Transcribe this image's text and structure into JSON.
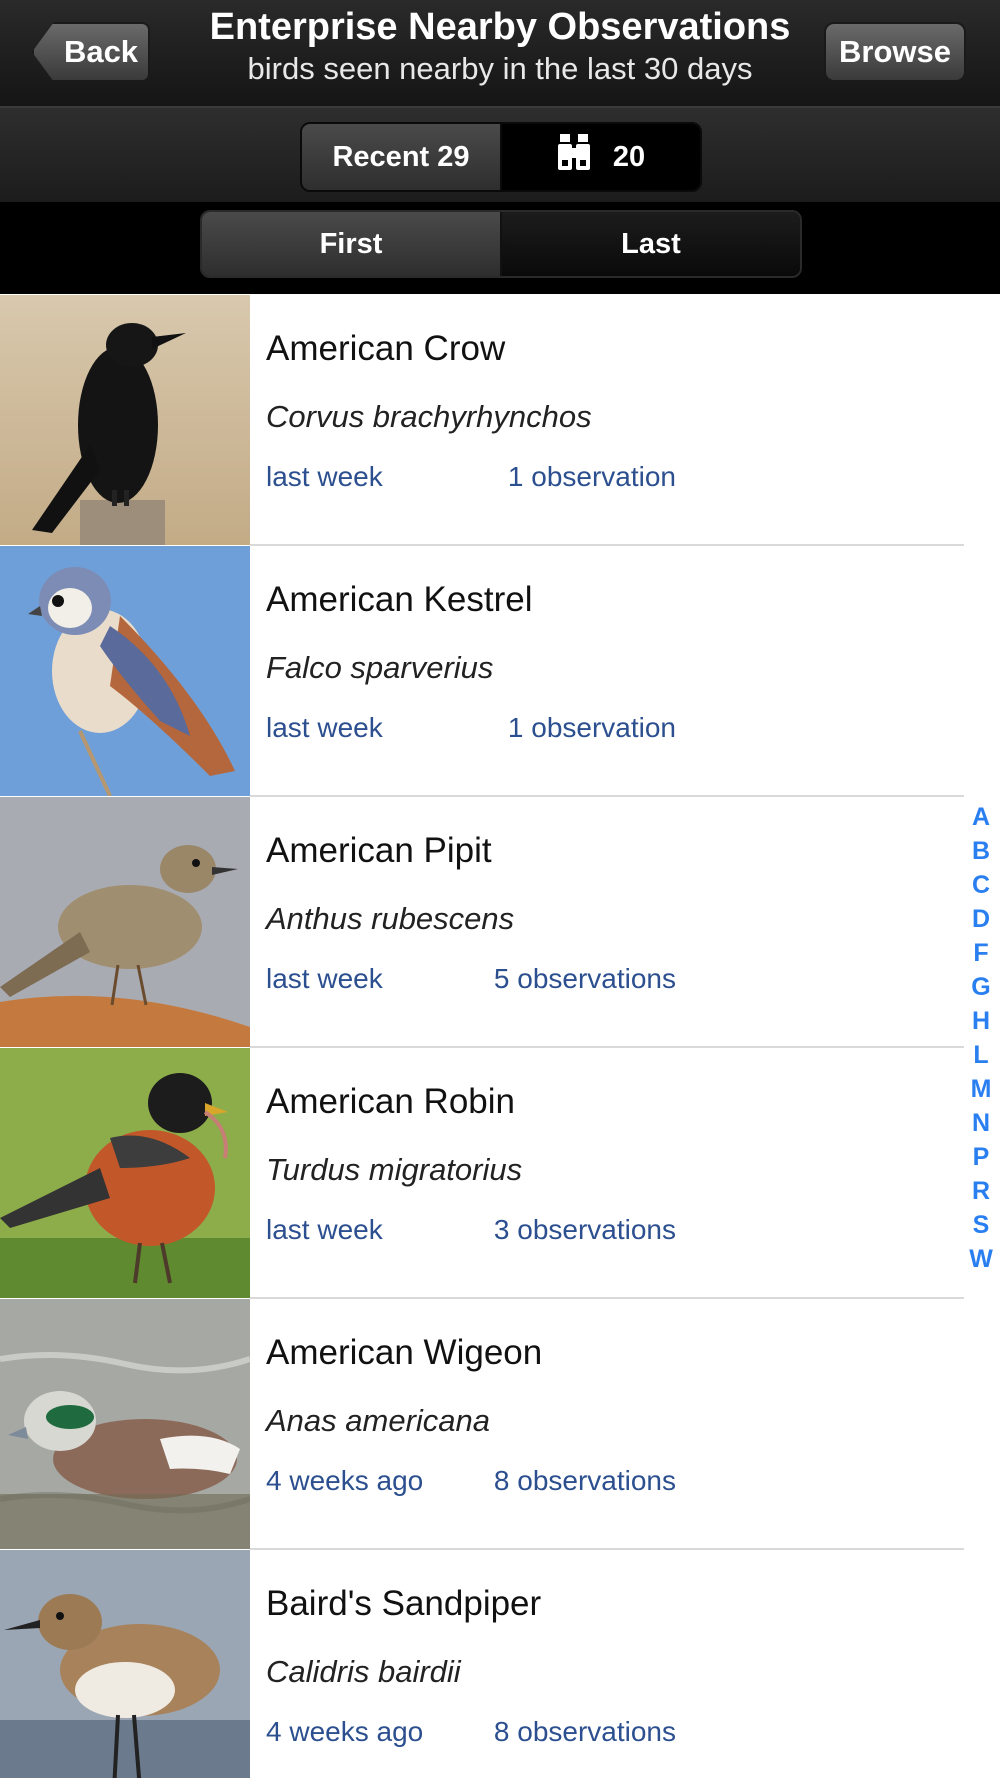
{
  "header": {
    "back_label": "Back",
    "title": "Enterprise Nearby Observations",
    "subtitle": "birds seen nearby in the last 30 days",
    "browse_label": "Browse"
  },
  "filter_tabs": {
    "recent_label": "Recent 29",
    "binoculars_count": "20",
    "selected": "Recent 29",
    "binoculars_icon": "binoculars-icon"
  },
  "sort_tabs": {
    "first_label": "First",
    "last_label": "Last",
    "selected": "First"
  },
  "birds": [
    {
      "common_name": "American Crow",
      "scientific_name": "Corvus brachyrhynchos",
      "last_seen": "last week",
      "observations": "1 observation"
    },
    {
      "common_name": "American Kestrel",
      "scientific_name": "Falco sparverius",
      "last_seen": "last week",
      "observations": "1 observation"
    },
    {
      "common_name": "American Pipit",
      "scientific_name": "Anthus rubescens",
      "last_seen": "last week",
      "observations": "5 observations"
    },
    {
      "common_name": "American Robin",
      "scientific_name": "Turdus migratorius",
      "last_seen": "last week",
      "observations": "3 observations"
    },
    {
      "common_name": "American Wigeon",
      "scientific_name": "Anas americana",
      "last_seen": "4 weeks ago",
      "observations": "8 observations"
    },
    {
      "common_name": "Baird's Sandpiper",
      "scientific_name": "Calidris bairdii",
      "last_seen": "4 weeks ago",
      "observations": "8 observations"
    }
  ],
  "alphabet_index": [
    "A",
    "B",
    "C",
    "D",
    "F",
    "G",
    "H",
    "L",
    "M",
    "N",
    "P",
    "R",
    "S",
    "W"
  ],
  "colors": {
    "link_blue": "#2c4f8f",
    "index_blue": "#2a7ff0",
    "header_dark": "#1e1e1e"
  }
}
